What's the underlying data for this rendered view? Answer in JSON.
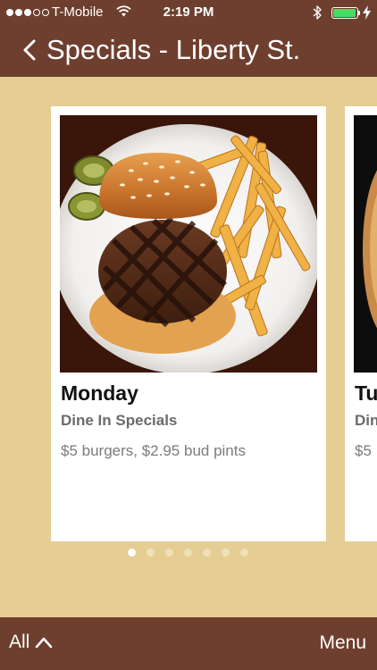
{
  "status_bar": {
    "carrier": "T-Mobile",
    "time": "2:19 PM",
    "signal_bars_filled": 3,
    "signal_bars_total": 5,
    "battery_level": 0.95
  },
  "header": {
    "title": "Specials - Liberty St."
  },
  "cards": [
    {
      "day": "Monday",
      "subtitle": "Dine In Specials",
      "description": "$5 burgers, $2.95 bud pints"
    },
    {
      "day": "Tu",
      "subtitle": "Din",
      "description": "$5"
    }
  ],
  "pager": {
    "total": 7,
    "active_index": 0
  },
  "bottom_bar": {
    "all_label": "All",
    "menu_label": "Menu"
  },
  "colors": {
    "bar_brown": "#6e3f2e",
    "background_tan": "#e5cd94",
    "battery_green": "#4cd964"
  }
}
